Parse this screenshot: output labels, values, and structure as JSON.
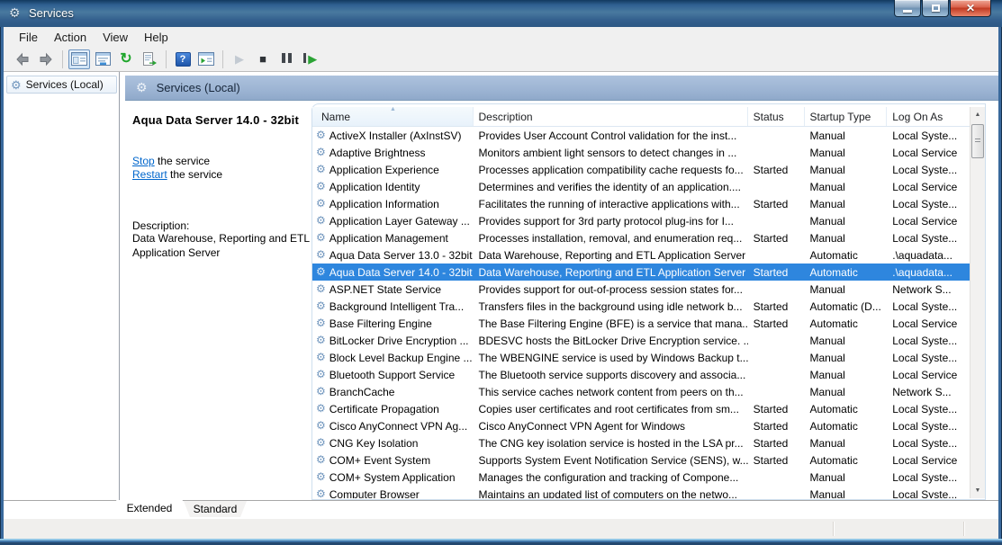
{
  "window": {
    "title": "Services"
  },
  "menu": {
    "items": [
      "File",
      "Action",
      "View",
      "Help"
    ]
  },
  "toolbar": {
    "buttons": [
      "back",
      "forward",
      "show-console-tree",
      "properties",
      "refresh",
      "export-list",
      "help",
      "show-action-pane",
      "start-service",
      "stop-service",
      "pause-service",
      "restart-service"
    ]
  },
  "tree": {
    "root": "Services (Local)"
  },
  "detail": {
    "header": "Services (Local)",
    "service_title": "Aqua Data Server 14.0 - 32bit",
    "stop_link": "Stop",
    "stop_suffix": " the service",
    "restart_link": "Restart",
    "restart_suffix": " the service",
    "description_label": "Description:",
    "description": "Data Warehouse, Reporting and ETL Application Server"
  },
  "table": {
    "columns": [
      "Name",
      "Description",
      "Status",
      "Startup Type",
      "Log On As"
    ],
    "sort": {
      "column": "Name",
      "direction": "ascending"
    },
    "rows": [
      {
        "name": "ActiveX Installer (AxInstSV)",
        "description": "Provides User Account Control validation for the inst...",
        "status": "",
        "startup": "Manual",
        "logon": "Local Syste...",
        "selected": false
      },
      {
        "name": "Adaptive Brightness",
        "description": "Monitors ambient light sensors to detect changes in ...",
        "status": "",
        "startup": "Manual",
        "logon": "Local Service",
        "selected": false
      },
      {
        "name": "Application Experience",
        "description": "Processes application compatibility cache requests fo...",
        "status": "Started",
        "startup": "Manual",
        "logon": "Local Syste...",
        "selected": false
      },
      {
        "name": "Application Identity",
        "description": "Determines and verifies the identity of an application....",
        "status": "",
        "startup": "Manual",
        "logon": "Local Service",
        "selected": false
      },
      {
        "name": "Application Information",
        "description": "Facilitates the running of interactive applications with...",
        "status": "Started",
        "startup": "Manual",
        "logon": "Local Syste...",
        "selected": false
      },
      {
        "name": "Application Layer Gateway ...",
        "description": "Provides support for 3rd party protocol plug-ins for I...",
        "status": "",
        "startup": "Manual",
        "logon": "Local Service",
        "selected": false
      },
      {
        "name": "Application Management",
        "description": "Processes installation, removal, and enumeration req...",
        "status": "Started",
        "startup": "Manual",
        "logon": "Local Syste...",
        "selected": false
      },
      {
        "name": "Aqua Data Server 13.0 - 32bit",
        "description": "Data Warehouse, Reporting and ETL Application Server",
        "status": "",
        "startup": "Automatic",
        "logon": ".\\aquadata...",
        "selected": false
      },
      {
        "name": "Aqua Data Server 14.0 - 32bit",
        "description": "Data Warehouse, Reporting and ETL Application Server",
        "status": "Started",
        "startup": "Automatic",
        "logon": ".\\aquadata...",
        "selected": true
      },
      {
        "name": "ASP.NET State Service",
        "description": "Provides support for out-of-process session states for...",
        "status": "",
        "startup": "Manual",
        "logon": "Network S...",
        "selected": false
      },
      {
        "name": "Background Intelligent Tra...",
        "description": "Transfers files in the background using idle network b...",
        "status": "Started",
        "startup": "Automatic (D...",
        "logon": "Local Syste...",
        "selected": false
      },
      {
        "name": "Base Filtering Engine",
        "description": "The Base Filtering Engine (BFE) is a service that mana...",
        "status": "Started",
        "startup": "Automatic",
        "logon": "Local Service",
        "selected": false
      },
      {
        "name": "BitLocker Drive Encryption ...",
        "description": "BDESVC hosts the BitLocker Drive Encryption service. ...",
        "status": "",
        "startup": "Manual",
        "logon": "Local Syste...",
        "selected": false
      },
      {
        "name": "Block Level Backup Engine ...",
        "description": "The WBENGINE service is used by Windows Backup t...",
        "status": "",
        "startup": "Manual",
        "logon": "Local Syste...",
        "selected": false
      },
      {
        "name": "Bluetooth Support Service",
        "description": "The Bluetooth service supports discovery and associa...",
        "status": "",
        "startup": "Manual",
        "logon": "Local Service",
        "selected": false
      },
      {
        "name": "BranchCache",
        "description": "This service caches network content from peers on th...",
        "status": "",
        "startup": "Manual",
        "logon": "Network S...",
        "selected": false
      },
      {
        "name": "Certificate Propagation",
        "description": "Copies user certificates and root certificates from sm...",
        "status": "Started",
        "startup": "Automatic",
        "logon": "Local Syste...",
        "selected": false
      },
      {
        "name": "Cisco AnyConnect VPN Ag...",
        "description": "Cisco AnyConnect VPN Agent for Windows",
        "status": "Started",
        "startup": "Automatic",
        "logon": "Local Syste...",
        "selected": false
      },
      {
        "name": "CNG Key Isolation",
        "description": "The CNG key isolation service is hosted in the LSA pr...",
        "status": "Started",
        "startup": "Manual",
        "logon": "Local Syste...",
        "selected": false
      },
      {
        "name": "COM+ Event System",
        "description": "Supports System Event Notification Service (SENS), w...",
        "status": "Started",
        "startup": "Automatic",
        "logon": "Local Service",
        "selected": false
      },
      {
        "name": "COM+ System Application",
        "description": "Manages the configuration and tracking of Compone...",
        "status": "",
        "startup": "Manual",
        "logon": "Local Syste...",
        "selected": false
      },
      {
        "name": "Computer Browser",
        "description": "Maintains an updated list of computers on the netwo...",
        "status": "",
        "startup": "Manual",
        "logon": "Local Syste...",
        "selected": false
      }
    ]
  },
  "tabs": {
    "items": [
      "Extended",
      "Standard"
    ],
    "active": "Extended"
  },
  "icons": {
    "gear": "⚙",
    "help_question": "?",
    "refresh": "↻",
    "play": "▶",
    "stop": "■",
    "sort_asc": "▲",
    "scroll_up": "▲",
    "scroll_down": "▼"
  },
  "colors": {
    "selection": "#2e86de",
    "link": "#0066cc",
    "titlebar": "#2f6091"
  }
}
